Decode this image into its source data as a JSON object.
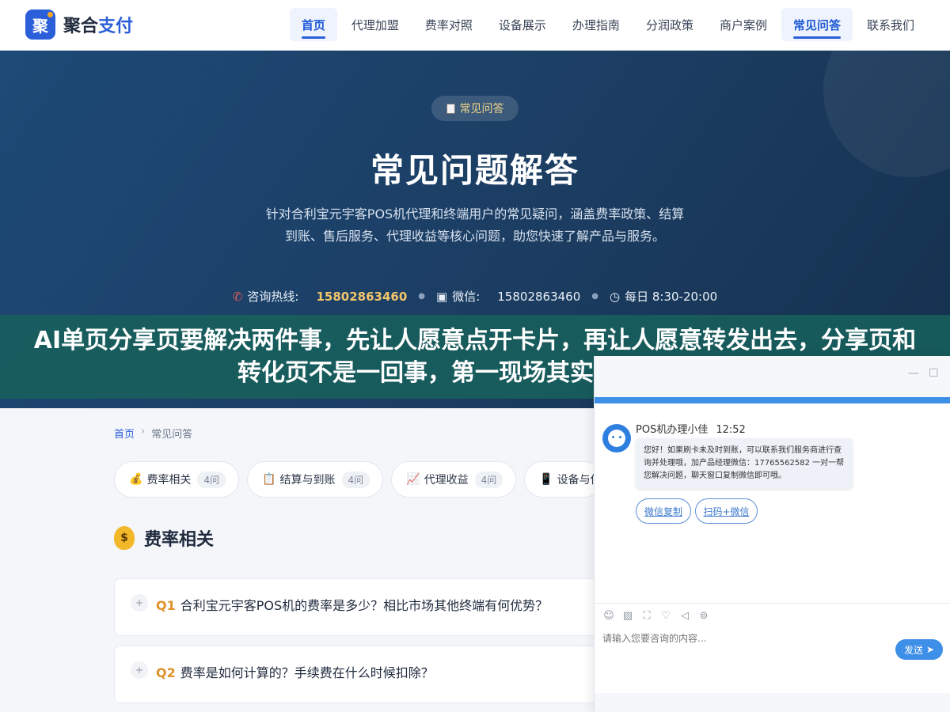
{
  "brand": {
    "logo_char": "聚",
    "name_main": "聚合",
    "name_accent": "支付"
  },
  "nav": {
    "items": [
      {
        "label": "首页",
        "active": true
      },
      {
        "label": "代理加盟",
        "active": false
      },
      {
        "label": "费率对照",
        "active": false
      },
      {
        "label": "设备展示",
        "active": false
      },
      {
        "label": "办理指南",
        "active": false
      },
      {
        "label": "分润政策",
        "active": false
      },
      {
        "label": "商户案例",
        "active": false
      },
      {
        "label": "常见问答",
        "active": true
      },
      {
        "label": "联系我们",
        "active": false
      }
    ]
  },
  "hero": {
    "badge": "常见问答",
    "title": "常见问题解答",
    "description": "针对合利宝元宇客POS机代理和终端用户的常见疑问，涵盖费率政策、结算到账、售后服务、代理收益等核心问题，助您快速了解产品与服务。",
    "hotline_label": "咨询热线:",
    "hotline_value": "15802863460",
    "wechat_label": "微信:",
    "wechat_value": "15802863460",
    "hours": "每日 8:30-20:00"
  },
  "banner": {
    "text": "AI单页分享页要解决两件事，先让人愿意点开卡片，再让人愿意转发出去，分享页和转化页不是一回事，第一现场其实是那张卡片"
  },
  "breadcrumb": {
    "home": "首页",
    "sep": "›",
    "current": "常见问答"
  },
  "categories": [
    {
      "icon": "💰",
      "label": "费率相关",
      "count": "4问"
    },
    {
      "icon": "📋",
      "label": "结算与到账",
      "count": "4问"
    },
    {
      "icon": "📈",
      "label": "代理收益",
      "count": "4问"
    },
    {
      "icon": "📱",
      "label": "设备与使",
      "count": ""
    }
  ],
  "section": {
    "icon": "$",
    "title": "费率相关"
  },
  "questions": [
    {
      "num": "Q1",
      "text": "合利宝元宇客POS机的费率是多少？相比市场其他终端有何优势？"
    },
    {
      "num": "Q2",
      "text": "费率是如何计算的？手续费在什么时候扣除？"
    }
  ],
  "chat": {
    "agent_name": "POS机办理小佳",
    "time": "12:52",
    "message": "您好！如果刷卡未及时到账，可以联系我们服务商进行查询并处理哦，加产品经理微信：17765562582 一对一帮您解决问题，聊天窗口复制微信即可哦。",
    "btn_copy": "微信复制",
    "btn_scan": "扫码+微信",
    "input_placeholder": "请输入您要咨询的内容...",
    "send_label": "发送",
    "accent_color": "#3d8fe8"
  }
}
